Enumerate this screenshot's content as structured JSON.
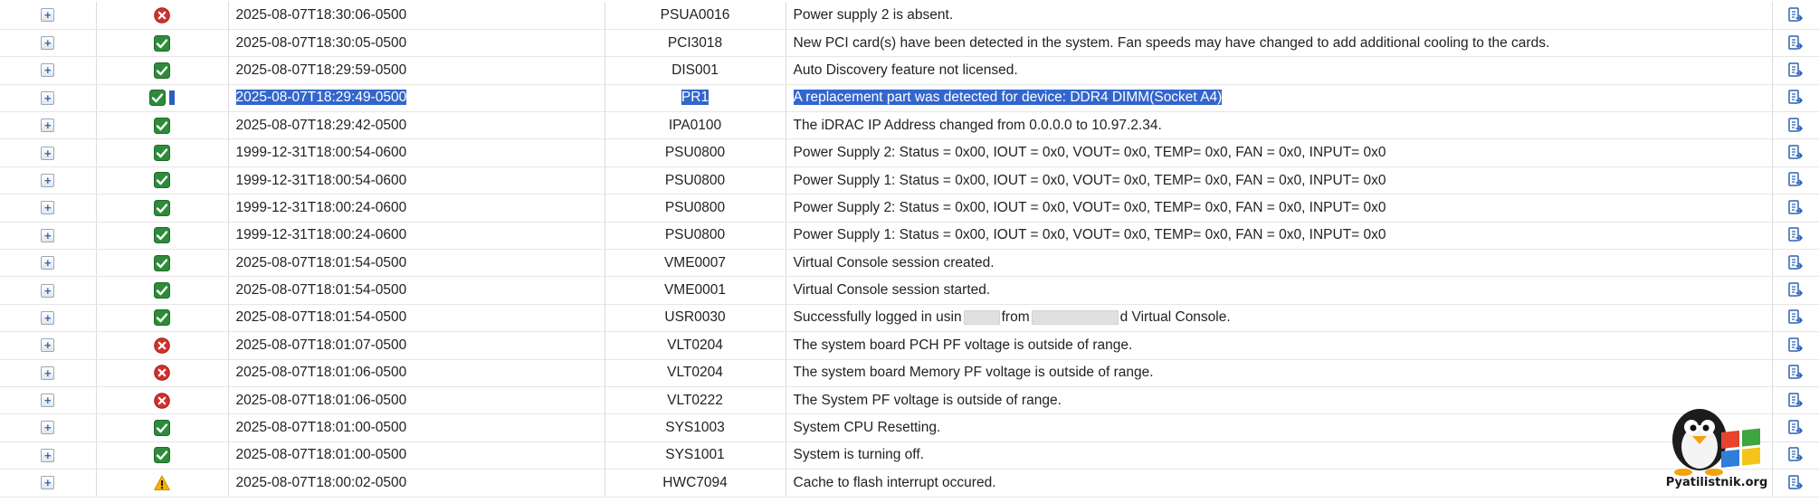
{
  "colors": {
    "ok": "#2e8b3a",
    "critical": "#d0312d",
    "warning": "#f4b400",
    "selection": "#3366cc",
    "grid": "#dcdcdc"
  },
  "icons": {
    "expand": "plus-box-icon",
    "ok": "green-checkmark-icon",
    "critical": "red-x-circle-icon",
    "warning": "yellow-warning-triangle-icon",
    "action": "blue-document-export-icon"
  },
  "log": {
    "rows": [
      {
        "expand": "+",
        "severity": "critical",
        "date": "2025-08-07T18:30:06-0500",
        "id": "PSUA0016",
        "message": "Power supply 2 is absent."
      },
      {
        "expand": "+",
        "severity": "ok",
        "date": "2025-08-07T18:30:05-0500",
        "id": "PCI3018",
        "message": "New PCI card(s) have been detected in the system. Fan speeds may have changed to add additional cooling to the cards."
      },
      {
        "expand": "+",
        "severity": "ok",
        "date": "2025-08-07T18:29:59-0500",
        "id": "DIS001",
        "message": "Auto Discovery feature not licensed."
      },
      {
        "expand": "+",
        "severity": "ok",
        "date": "2025-08-07T18:29:49-0500",
        "id": "PR1",
        "message": "A replacement part was detected for device: DDR4 DIMM(Socket A4)",
        "selected": true
      },
      {
        "expand": "+",
        "severity": "ok",
        "date": "2025-08-07T18:29:42-0500",
        "id": "IPA0100",
        "message": "The iDRAC IP Address changed from 0.0.0.0 to 10.97.2.34."
      },
      {
        "expand": "+",
        "severity": "ok",
        "date": "1999-12-31T18:00:54-0600",
        "id": "PSU0800",
        "message": "Power Supply 2: Status = 0x00, IOUT = 0x0, VOUT= 0x0, TEMP= 0x0, FAN = 0x0, INPUT= 0x0"
      },
      {
        "expand": "+",
        "severity": "ok",
        "date": "1999-12-31T18:00:54-0600",
        "id": "PSU0800",
        "message": "Power Supply 1: Status = 0x00, IOUT = 0x0, VOUT= 0x0, TEMP= 0x0, FAN = 0x0, INPUT= 0x0"
      },
      {
        "expand": "+",
        "severity": "ok",
        "date": "1999-12-31T18:00:24-0600",
        "id": "PSU0800",
        "message": "Power Supply 2: Status = 0x00, IOUT = 0x0, VOUT= 0x0, TEMP= 0x0, FAN = 0x0, INPUT= 0x0"
      },
      {
        "expand": "+",
        "severity": "ok",
        "date": "1999-12-31T18:00:24-0600",
        "id": "PSU0800",
        "message": "Power Supply 1: Status = 0x00, IOUT = 0x0, VOUT= 0x0, TEMP= 0x0, FAN = 0x0, INPUT= 0x0"
      },
      {
        "expand": "+",
        "severity": "ok",
        "date": "2025-08-07T18:01:54-0500",
        "id": "VME0007",
        "message": "Virtual Console session created."
      },
      {
        "expand": "+",
        "severity": "ok",
        "date": "2025-08-07T18:01:54-0500",
        "id": "VME0001",
        "message": "Virtual Console session started."
      },
      {
        "expand": "+",
        "severity": "ok",
        "date": "2025-08-07T18:01:54-0500",
        "id": "USR0030",
        "message": "",
        "message_parts": [
          "Successfully logged in usin",
          "from",
          "d Virtual Console."
        ]
      },
      {
        "expand": "+",
        "severity": "critical",
        "date": "2025-08-07T18:01:07-0500",
        "id": "VLT0204",
        "message": "The system board PCH PF voltage is outside of range."
      },
      {
        "expand": "+",
        "severity": "critical",
        "date": "2025-08-07T18:01:06-0500",
        "id": "VLT0204",
        "message": "The system board Memory PF voltage is outside of range."
      },
      {
        "expand": "+",
        "severity": "critical",
        "date": "2025-08-07T18:01:06-0500",
        "id": "VLT0222",
        "message": "The System PF voltage is outside of range."
      },
      {
        "expand": "+",
        "severity": "ok",
        "date": "2025-08-07T18:01:00-0500",
        "id": "SYS1003",
        "message": "System CPU Resetting."
      },
      {
        "expand": "+",
        "severity": "ok",
        "date": "2025-08-07T18:01:00-0500",
        "id": "SYS1001",
        "message": "System is turning off."
      },
      {
        "expand": "+",
        "severity": "warning",
        "date": "2025-08-07T18:00:02-0500",
        "id": "HWC7094",
        "message": "Cache to flash interrupt occured."
      }
    ]
  },
  "watermark": {
    "label": "Pyatilistnik.org"
  }
}
